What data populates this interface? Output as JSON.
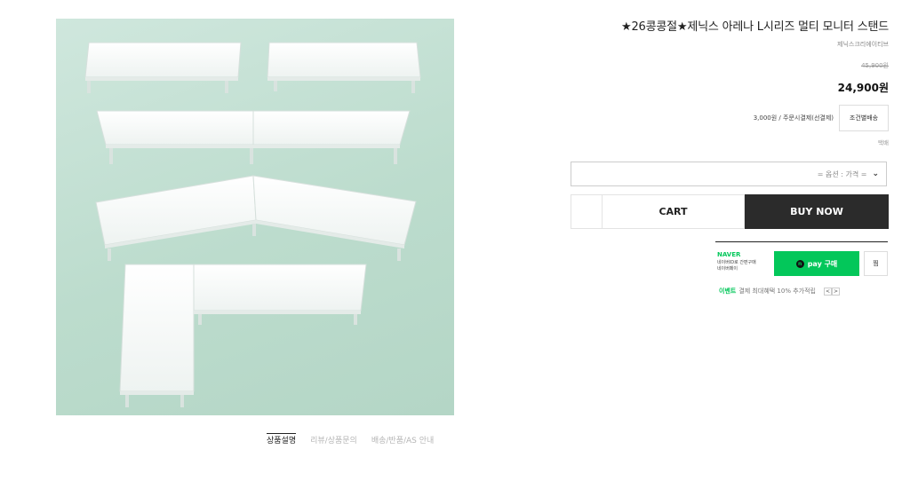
{
  "product": {
    "title": "★26콩콩절★제닉스 아레나 L시리즈 멀티 모니터 스탠드",
    "brand": "제닉스크리에이티브",
    "original_price": "45,900원",
    "price": "24,900원",
    "shipping_text": "3,000원  / 주문시결제(선결제)",
    "shipping_button": "조건별배송",
    "courier": "택배",
    "option_placeholder": "= 옵션 : 가격 =",
    "cart_label": "CART",
    "buy_label": "BUY NOW"
  },
  "npay": {
    "logo": "NAVER",
    "sub1": "네이버ID로 간편구매",
    "sub2": "네이버페이",
    "pay_icon": "n",
    "pay_label": "pay 구매",
    "jjim_label": "찜",
    "event_label": "이벤트",
    "event_text": "결제 최대혜택 10% 추가적립",
    "prev": "<",
    "next": ">"
  },
  "tabs": [
    {
      "label": "상품설명",
      "active": true
    },
    {
      "label": "리뷰/상품문의",
      "active": false
    },
    {
      "label": "배송/반품/AS 안내",
      "active": false
    }
  ],
  "icons": {
    "dropdown": "chevron-down-icon",
    "wishlist": "wishlist-icon",
    "pay": "npay-icon"
  },
  "colors": {
    "accent": "#03c75a",
    "buy_background": "#2b2b2b",
    "image_background": "#bcdccd"
  }
}
